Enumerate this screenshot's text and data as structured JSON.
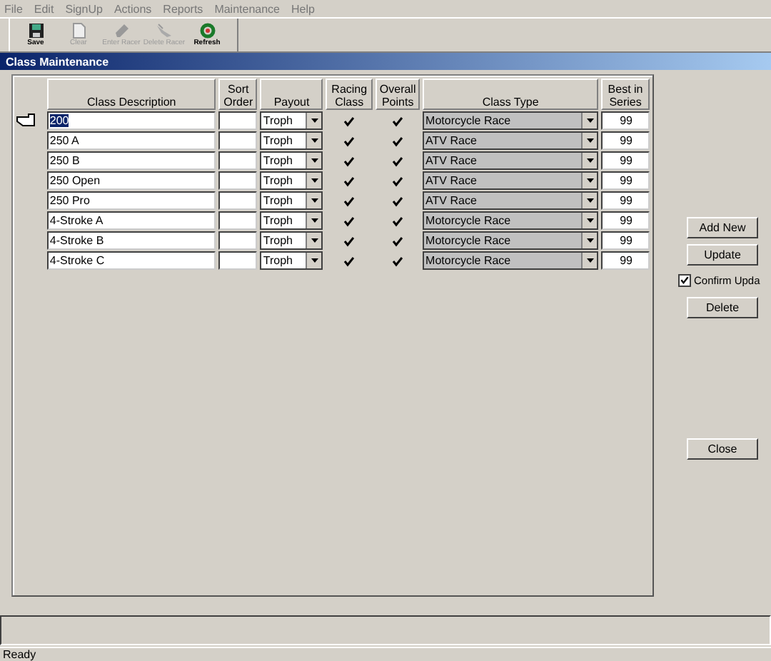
{
  "menu": [
    "File",
    "Edit",
    "SignUp",
    "Actions",
    "Reports",
    "Maintenance",
    "Help"
  ],
  "toolbar": [
    {
      "kind": "save",
      "label": "Save",
      "disabled": false
    },
    {
      "kind": "clear",
      "label": "Clear",
      "disabled": true
    },
    {
      "kind": "enter",
      "label": "Enter Racer",
      "disabled": true
    },
    {
      "kind": "delete",
      "label": "Delete Racer",
      "disabled": true
    },
    {
      "kind": "refresh",
      "label": "Refresh",
      "disabled": false
    }
  ],
  "window": {
    "title": "Class Maintenance"
  },
  "table": {
    "columns": [
      "Class Description",
      "Sort Order",
      "Payout",
      "Racing Class",
      "Overall Points",
      "Class Type",
      "Best in Series"
    ],
    "rows": [
      {
        "selected": true,
        "description": "200",
        "sort_order": "",
        "payout": "Troph",
        "racing_class": true,
        "overall_points": true,
        "class_type": "Motorcycle Race",
        "best_in_series": "99"
      },
      {
        "selected": false,
        "description": "250 A",
        "sort_order": "",
        "payout": "Troph",
        "racing_class": true,
        "overall_points": true,
        "class_type": "ATV Race",
        "best_in_series": "99"
      },
      {
        "selected": false,
        "description": "250 B",
        "sort_order": "",
        "payout": "Troph",
        "racing_class": true,
        "overall_points": true,
        "class_type": "ATV Race",
        "best_in_series": "99"
      },
      {
        "selected": false,
        "description": "250 Open",
        "sort_order": "",
        "payout": "Troph",
        "racing_class": true,
        "overall_points": true,
        "class_type": "ATV Race",
        "best_in_series": "99"
      },
      {
        "selected": false,
        "description": "250 Pro",
        "sort_order": "",
        "payout": "Troph",
        "racing_class": true,
        "overall_points": true,
        "class_type": "ATV Race",
        "best_in_series": "99"
      },
      {
        "selected": false,
        "description": "4-Stroke A",
        "sort_order": "",
        "payout": "Troph",
        "racing_class": true,
        "overall_points": true,
        "class_type": "Motorcycle Race",
        "best_in_series": "99"
      },
      {
        "selected": false,
        "description": "4-Stroke B",
        "sort_order": "",
        "payout": "Troph",
        "racing_class": true,
        "overall_points": true,
        "class_type": "Motorcycle Race",
        "best_in_series": "99"
      },
      {
        "selected": false,
        "description": "4-Stroke C",
        "sort_order": "",
        "payout": "Troph",
        "racing_class": true,
        "overall_points": true,
        "class_type": "Motorcycle Race",
        "best_in_series": "99"
      }
    ]
  },
  "buttons_top": [
    "Add New",
    "Update"
  ],
  "confirm_update": {
    "label": "Confirm Upda",
    "checked": true
  },
  "button_delete": "Delete",
  "button_close": "Close",
  "status_bar": "Ready"
}
